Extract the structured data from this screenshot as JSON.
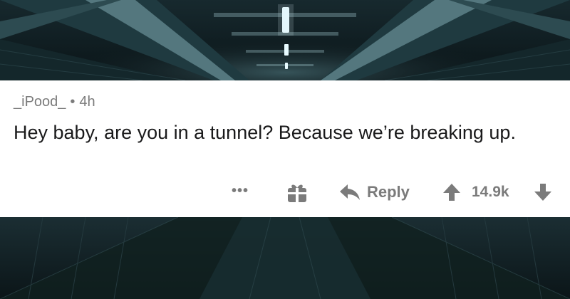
{
  "comment": {
    "username": "_iPood_",
    "separator": "•",
    "age": "4h",
    "text": "Hey baby, are you in a tunnel? Because we’re breaking up."
  },
  "actions": {
    "more_label": "•••",
    "reply_label": "Reply",
    "score": "14.9k"
  },
  "colors": {
    "meta_text": "#7b7b7b",
    "body_text": "#1a1a1b",
    "card_bg": "#ffffff",
    "tunnel_dark": "#0d1a1e",
    "tunnel_light": "#cfe6ea"
  },
  "icons": [
    "more-icon",
    "gift-icon",
    "reply-arrow-icon",
    "upvote-arrow-icon",
    "downvote-arrow-icon"
  ]
}
